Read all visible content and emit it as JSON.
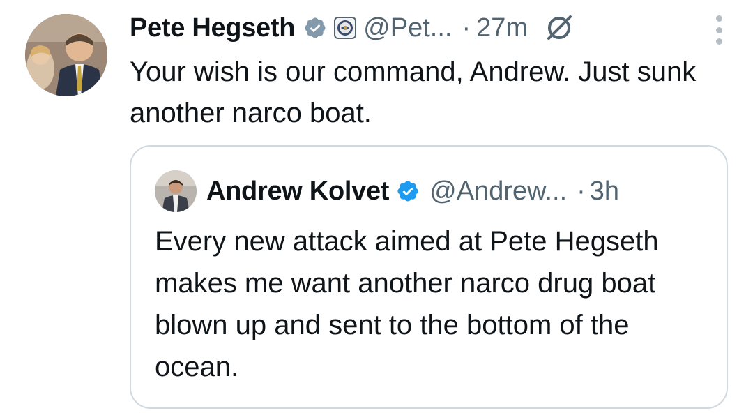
{
  "tweet": {
    "author_name": "Pete Hegseth",
    "author_handle": "@Pet...",
    "separator": "·",
    "time": "27m",
    "text": "Your wish is our command, Andrew. Just sunk another narco boat.",
    "avatar_icon": "profile-photo",
    "verified_icon": "verified-badge-icon",
    "affiliation_icon": "department-seal-icon",
    "grok_icon": "grok-icon",
    "more_icon": "more-vertical-icon"
  },
  "quoted": {
    "author_name": "Andrew Kolvet",
    "author_handle": "@Andrew...",
    "separator": "·",
    "time": "3h",
    "text": "Every new attack aimed at Pete Hegseth makes me want another narco drug boat blown up and sent to the bottom of the ocean.",
    "avatar_icon": "profile-photo",
    "verified_icon": "verified-badge-icon"
  },
  "colors": {
    "text": "#0f1419",
    "secondary": "#536471",
    "verified": "#1d9bf0",
    "border": "#cfd9de"
  }
}
